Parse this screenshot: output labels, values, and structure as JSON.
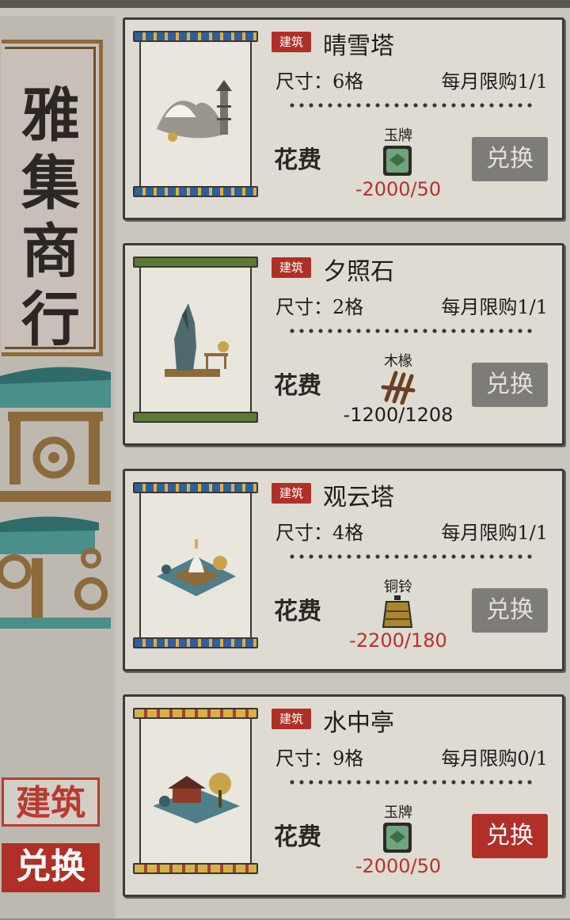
{
  "title": "雅集商行",
  "side_tabs": {
    "build": "建筑",
    "exchange": "兑换"
  },
  "colors": {
    "accent_red": "#b02f27",
    "price_red": "#b4332b",
    "disabled_gray": "#7e7c78"
  },
  "cards": [
    {
      "tag": "建筑",
      "name": "晴雪塔",
      "size": "尺寸：6格",
      "limit": "每月限购1/1",
      "cost_label": "花费",
      "item": "玉牌",
      "item_icon": "jade-token-icon",
      "price": "-2000/50",
      "price_color": "red",
      "button": "兑换",
      "button_enabled": false,
      "rod_style": "blue"
    },
    {
      "tag": "建筑",
      "name": "夕照石",
      "size": "尺寸：2格",
      "limit": "每月限购1/1",
      "cost_label": "花费",
      "item": "木椽",
      "item_icon": "wooden-rafter-icon",
      "price": "-1200/1208",
      "price_color": "black",
      "button": "兑换",
      "button_enabled": false,
      "rod_style": "green"
    },
    {
      "tag": "建筑",
      "name": "观云塔",
      "size": "尺寸：4格",
      "limit": "每月限购1/1",
      "cost_label": "花费",
      "item": "铜铃",
      "item_icon": "bronze-bell-icon",
      "price": "-2200/180",
      "price_color": "red",
      "button": "兑换",
      "button_enabled": false,
      "rod_style": "blue"
    },
    {
      "tag": "建筑",
      "name": "水中亭",
      "size": "尺寸：9格",
      "limit": "每月限购0/1",
      "cost_label": "花费",
      "item": "玉牌",
      "item_icon": "jade-token-icon",
      "price": "-2000/50",
      "price_color": "red",
      "button": "兑换",
      "button_enabled": true,
      "rod_style": "gold"
    }
  ]
}
